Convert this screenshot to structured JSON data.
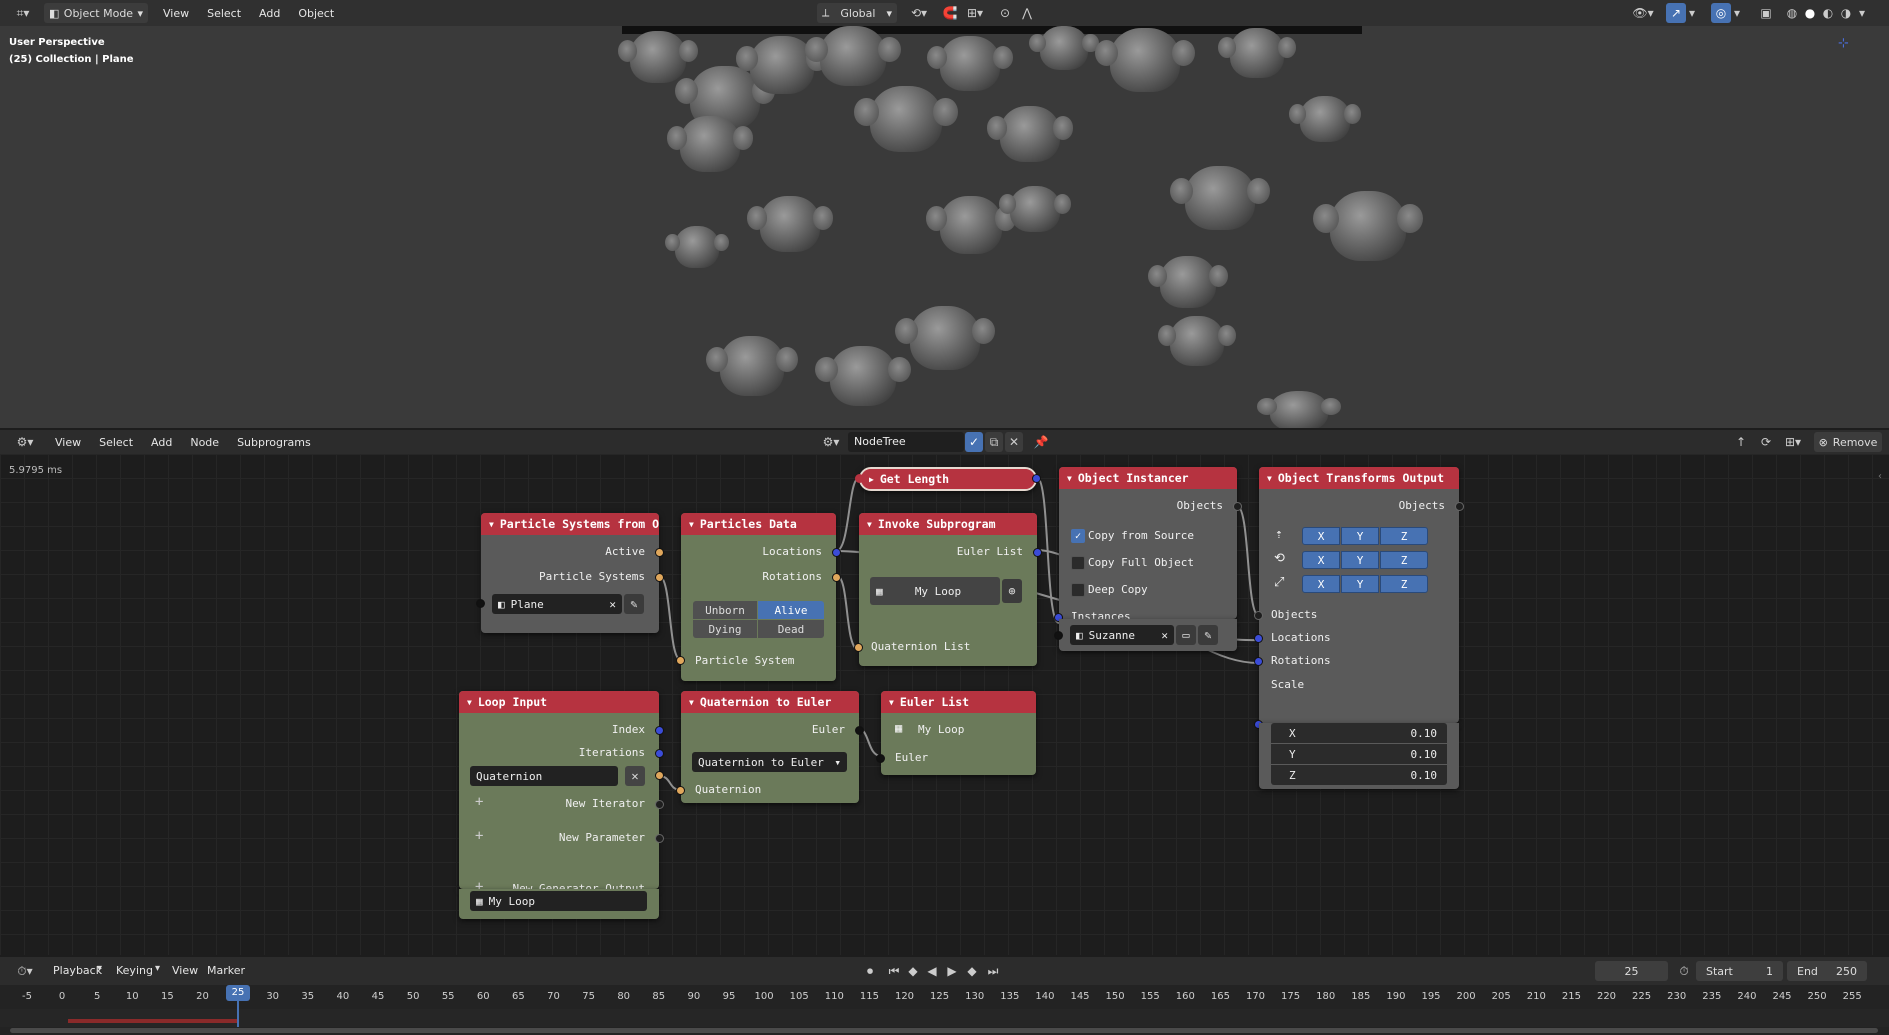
{
  "top_header": {
    "mode": "Object Mode",
    "menus": [
      "View",
      "Select",
      "Add",
      "Object"
    ],
    "transform_orientation": "Global"
  },
  "viewport": {
    "perspective": "User Perspective",
    "collection": "(25) Collection | Plane"
  },
  "node_header": {
    "menus": [
      "View",
      "Select",
      "Add",
      "Node",
      "Subprograms"
    ],
    "tree_name": "NodeTree",
    "remove_label": "Remove"
  },
  "editor": {
    "timing": "5.9795 ms"
  },
  "nodes": {
    "particle_systems": {
      "title": "Particle Systems from O…",
      "outputs": [
        "Active",
        "Particle Systems"
      ],
      "object": "Plane"
    },
    "particles_data": {
      "title": "Particles Data",
      "outputs": [
        "Locations",
        "Rotations"
      ],
      "toggles": [
        "Unborn",
        "Alive",
        "Dying",
        "Dead"
      ],
      "input": "Particle System"
    },
    "get_length": {
      "title": "Get Length"
    },
    "invoke_subprogram": {
      "title": "Invoke Subprogram",
      "output": "Euler List",
      "subprogram": "My Loop",
      "input": "Quaternion List"
    },
    "object_instancer": {
      "title": "Object Instancer",
      "output": "Objects",
      "options": [
        "Copy from Source",
        "Copy Full Object",
        "Deep Copy"
      ],
      "input": "Instances",
      "object": "Suzanne"
    },
    "object_transforms_output": {
      "title": "Object Transforms Output",
      "output": "Objects",
      "axes": [
        "X",
        "Y",
        "Z"
      ],
      "inputs": [
        "Objects",
        "Locations",
        "Rotations",
        "Scale"
      ],
      "scale": [
        {
          "axis": "X",
          "value": "0.10"
        },
        {
          "axis": "Y",
          "value": "0.10"
        },
        {
          "axis": "Z",
          "value": "0.10"
        }
      ]
    },
    "loop_input": {
      "title": "Loop Input",
      "outputs": [
        "Index",
        "Iterations"
      ],
      "iterator": "Quaternion",
      "new_iterator": "New Iterator",
      "new_parameter": "New Parameter",
      "new_generator_output": "New Generator Output",
      "loop": "My Loop"
    },
    "quaternion_to_euler": {
      "title": "Quaternion to Euler",
      "output": "Euler",
      "mode": "Quaternion to Euler",
      "input": "Quaternion"
    },
    "euler_list": {
      "title": "Euler List",
      "loop": "My Loop",
      "input": "Euler"
    }
  },
  "timeline": {
    "menus": [
      "Playback",
      "Keying",
      "View",
      "Marker"
    ],
    "current_frame": "25",
    "start_label": "Start",
    "start": "1",
    "end_label": "End",
    "end": "250",
    "ticks": [
      "-5",
      "0",
      "5",
      "10",
      "15",
      "20",
      "25",
      "30",
      "35",
      "40",
      "45",
      "50",
      "55",
      "60",
      "65",
      "70",
      "75",
      "80",
      "85",
      "90",
      "95",
      "100",
      "105",
      "110",
      "115",
      "120",
      "125",
      "130",
      "135",
      "140",
      "145",
      "150",
      "155",
      "160",
      "165",
      "170",
      "175",
      "180",
      "185",
      "190",
      "195",
      "200",
      "205",
      "210",
      "215",
      "220",
      "225",
      "230",
      "235",
      "240",
      "245",
      "250",
      "255"
    ]
  }
}
